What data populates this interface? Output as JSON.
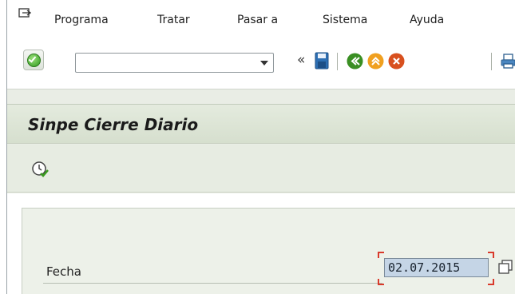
{
  "menubar": {
    "items": [
      {
        "label": "Programa"
      },
      {
        "label": "Tratar"
      },
      {
        "label": "Pasar a"
      },
      {
        "label": "Sistema"
      },
      {
        "label": "Ayuda"
      }
    ]
  },
  "toolbar": {
    "command_field": {
      "value": "",
      "placeholder": ""
    },
    "icons": [
      "check-icon",
      "dropdown-arrow-icon",
      "double-left-arrow-icon",
      "save-icon",
      "back-icon",
      "exit-icon",
      "cancel-icon",
      "print-icon"
    ],
    "colors": {
      "ok": "#2f9a1e",
      "back": "#3a8f23",
      "exit": "#f0a020",
      "cancel": "#d8501e"
    }
  },
  "title": {
    "text": "Sinpe Cierre Diario"
  },
  "appbar": {
    "icons": [
      "execute-icon"
    ]
  },
  "form": {
    "fecha_label": "Fecha",
    "fecha_value": "02.07.2015",
    "highlight_color": "#d93a2b"
  }
}
